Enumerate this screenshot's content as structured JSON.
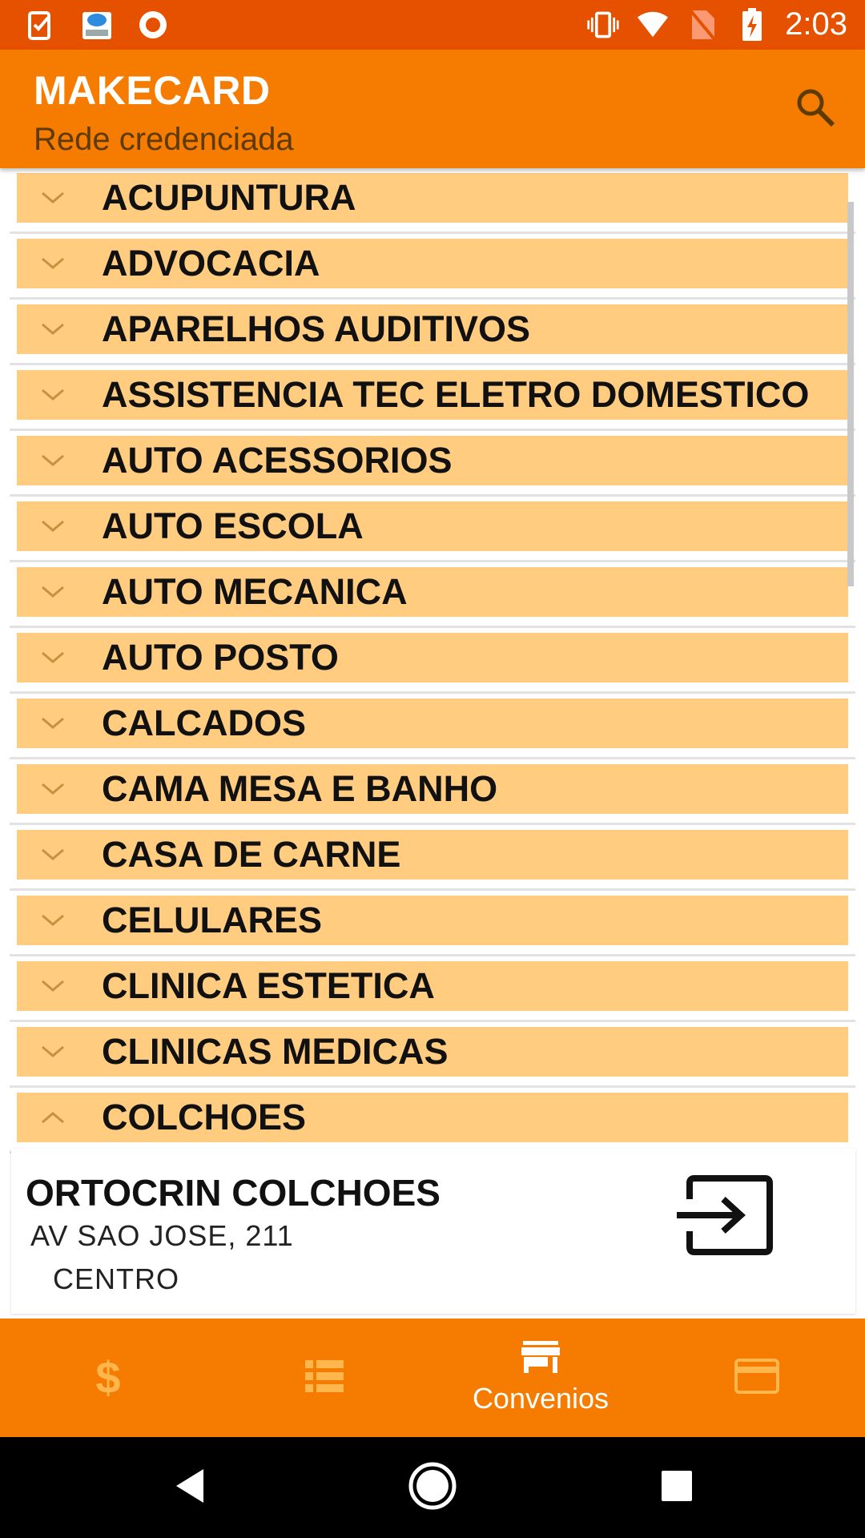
{
  "status_bar": {
    "time": "2:03",
    "icons_left": [
      "task-check-icon",
      "cloud-calendar-icon",
      "record-icon"
    ],
    "icons_right": [
      "vibrate-icon",
      "wifi-icon",
      "no-sim-icon",
      "battery-charging-icon"
    ]
  },
  "app_bar": {
    "title": "MAKECARD",
    "subtitle": "Rede credenciada",
    "search_icon": "search-icon"
  },
  "categories": [
    {
      "label": "ACUPUNTURA",
      "expanded": false
    },
    {
      "label": "ADVOCACIA",
      "expanded": false
    },
    {
      "label": "APARELHOS AUDITIVOS",
      "expanded": false
    },
    {
      "label": "ASSISTENCIA TEC ELETRO DOMESTICO",
      "expanded": false
    },
    {
      "label": "AUTO ACESSORIOS",
      "expanded": false
    },
    {
      "label": "AUTO ESCOLA",
      "expanded": false
    },
    {
      "label": "AUTO MECANICA",
      "expanded": false
    },
    {
      "label": "AUTO POSTO",
      "expanded": false
    },
    {
      "label": "CALCADOS",
      "expanded": false
    },
    {
      "label": "CAMA MESA E BANHO",
      "expanded": false
    },
    {
      "label": "CASA DE CARNE",
      "expanded": false
    },
    {
      "label": "CELULARES",
      "expanded": false
    },
    {
      "label": "CLINICA ESTETICA",
      "expanded": false
    },
    {
      "label": "CLINICAS MEDICAS",
      "expanded": false
    },
    {
      "label": "COLCHOES",
      "expanded": true
    }
  ],
  "detail": {
    "name": "ORTOCRIN COLCHOES",
    "address": "AV SAO JOSE, 211",
    "district": "CENTRO",
    "action_icon": "open-input-icon"
  },
  "bottom_nav": [
    {
      "icon": "dollar-icon",
      "label": "",
      "active": false
    },
    {
      "icon": "list-icon",
      "label": "",
      "active": false
    },
    {
      "icon": "store-icon",
      "label": "Convenios",
      "active": true
    },
    {
      "icon": "credit-card-icon",
      "label": "",
      "active": false
    }
  ],
  "colors": {
    "status_bar": "#e65100",
    "primary": "#f57c00",
    "category_bar": "#ffcc80",
    "chevron": "#c4933f"
  }
}
